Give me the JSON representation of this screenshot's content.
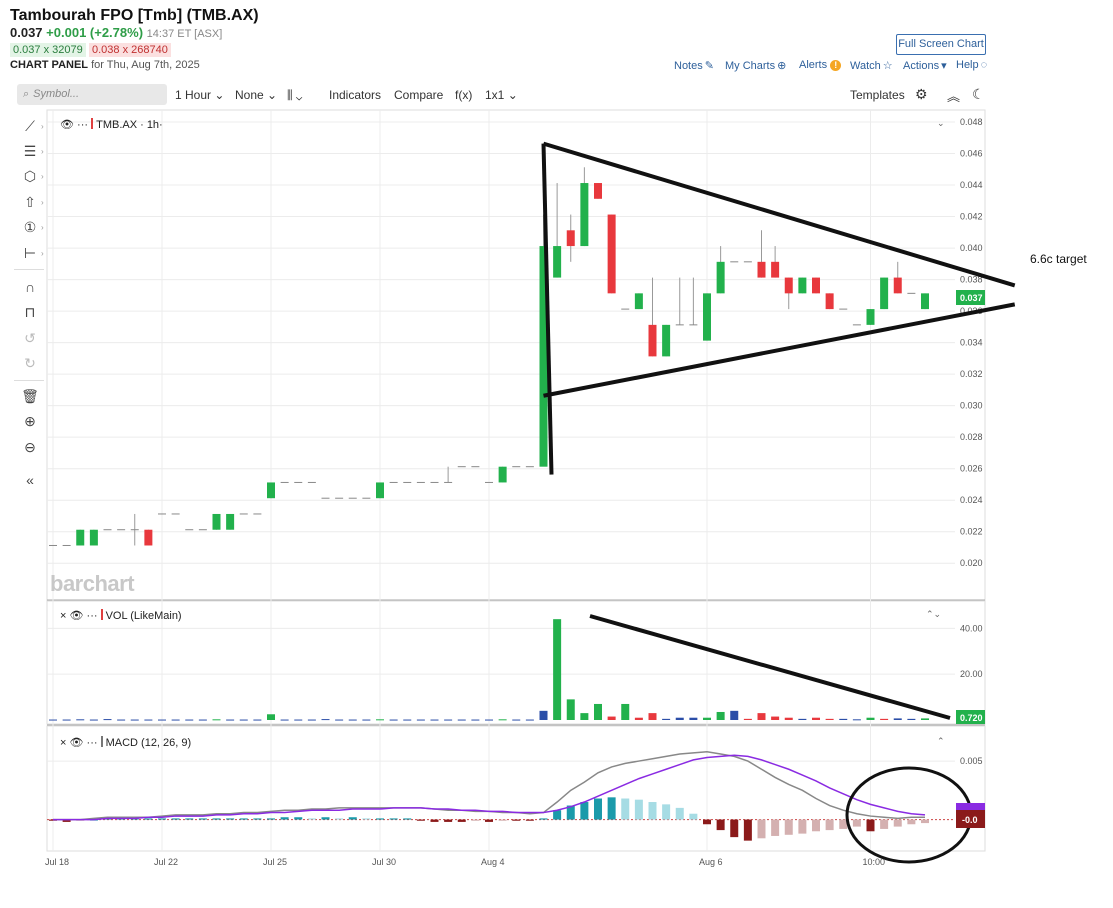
{
  "header": {
    "title": "Tambourah FPO [Tmb] (TMB.AX)",
    "last": "0.037",
    "change": "+0.001 (+2.78%)",
    "time": "14:37 ET [ASX]",
    "bid": "0.037 x 32079",
    "ask": "0.038 x 268740",
    "panel_label": "CHART PANEL",
    "panel_date": "for Thu, Aug 7th, 2025",
    "full_screen": "Full Screen Chart",
    "links": {
      "notes": "Notes",
      "my_charts": "My Charts",
      "alerts": "Alerts",
      "watch": "Watch",
      "actions": "Actions",
      "help": "Help"
    }
  },
  "toolbar": {
    "search_placeholder": "Symbol...",
    "interval": "1 Hour",
    "none": "None",
    "indicators": "Indicators",
    "compare": "Compare",
    "fx": "f(x)",
    "layout": "1x1",
    "templates": "Templates"
  },
  "panes": {
    "price_label": "TMB.AX · 1h·",
    "volume_label": "VOL (LikeMain)",
    "macd_label": "MACD (12, 26, 9)",
    "price_badge": "0.037",
    "volume_badge": "0.720",
    "macd_badge": "-0.0"
  },
  "annotation": "6.6c target",
  "watermark": "barchart",
  "colors": {
    "up": "#22b14c",
    "down": "#e8383d",
    "vol_blue": "#2b4ea8",
    "macd_line": "#888888",
    "signal_line": "#8a2be2",
    "hist_pos_strong": "#1b9aaa",
    "hist_pos_weak": "#a6dce4",
    "hist_neg_strong": "#8b1a1a",
    "hist_neg_weak": "#d4b0b0",
    "link": "#2d5f9a"
  },
  "chart_data": [
    {
      "type": "candlestick",
      "symbol": "TMB.AX",
      "interval": "1h",
      "ylim": [
        0.019,
        0.048
      ],
      "yticks": [
        "0.048",
        "0.046",
        "0.044",
        "0.042",
        "0.040",
        "0.038",
        "0.036",
        "0.034",
        "0.032",
        "0.030",
        "0.028",
        "0.026",
        "0.024",
        "0.022",
        "0.020"
      ],
      "xticks": [
        "Jul 18",
        "Jul 22",
        "Jul 25",
        "Jul 30",
        "Aug 4",
        "Aug 6",
        "10:00"
      ],
      "candles": [
        {
          "o": 0.021,
          "h": 0.021,
          "l": 0.021,
          "c": 0.021
        },
        {
          "o": 0.021,
          "h": 0.021,
          "l": 0.021,
          "c": 0.021
        },
        {
          "o": 0.021,
          "h": 0.022,
          "l": 0.021,
          "c": 0.022
        },
        {
          "o": 0.021,
          "h": 0.022,
          "l": 0.021,
          "c": 0.022
        },
        {
          "o": 0.022,
          "h": 0.022,
          "l": 0.022,
          "c": 0.022
        },
        {
          "o": 0.022,
          "h": 0.022,
          "l": 0.022,
          "c": 0.022
        },
        {
          "o": 0.022,
          "h": 0.023,
          "l": 0.021,
          "c": 0.022
        },
        {
          "o": 0.022,
          "h": 0.022,
          "l": 0.021,
          "c": 0.021
        },
        {
          "o": 0.023,
          "h": 0.023,
          "l": 0.023,
          "c": 0.023
        },
        {
          "o": 0.023,
          "h": 0.023,
          "l": 0.023,
          "c": 0.023
        },
        {
          "o": 0.022,
          "h": 0.022,
          "l": 0.022,
          "c": 0.022
        },
        {
          "o": 0.022,
          "h": 0.022,
          "l": 0.022,
          "c": 0.022
        },
        {
          "o": 0.022,
          "h": 0.023,
          "l": 0.022,
          "c": 0.023
        },
        {
          "o": 0.022,
          "h": 0.023,
          "l": 0.022,
          "c": 0.023
        },
        {
          "o": 0.023,
          "h": 0.023,
          "l": 0.023,
          "c": 0.023
        },
        {
          "o": 0.023,
          "h": 0.023,
          "l": 0.023,
          "c": 0.023
        },
        {
          "o": 0.024,
          "h": 0.025,
          "l": 0.024,
          "c": 0.025
        },
        {
          "o": 0.025,
          "h": 0.025,
          "l": 0.025,
          "c": 0.025
        },
        {
          "o": 0.025,
          "h": 0.025,
          "l": 0.025,
          "c": 0.025
        },
        {
          "o": 0.025,
          "h": 0.025,
          "l": 0.025,
          "c": 0.025
        },
        {
          "o": 0.024,
          "h": 0.024,
          "l": 0.024,
          "c": 0.024
        },
        {
          "o": 0.024,
          "h": 0.024,
          "l": 0.024,
          "c": 0.024
        },
        {
          "o": 0.024,
          "h": 0.024,
          "l": 0.024,
          "c": 0.024
        },
        {
          "o": 0.024,
          "h": 0.024,
          "l": 0.024,
          "c": 0.024
        },
        {
          "o": 0.024,
          "h": 0.025,
          "l": 0.024,
          "c": 0.025
        },
        {
          "o": 0.025,
          "h": 0.025,
          "l": 0.025,
          "c": 0.025
        },
        {
          "o": 0.025,
          "h": 0.025,
          "l": 0.025,
          "c": 0.025
        },
        {
          "o": 0.025,
          "h": 0.025,
          "l": 0.025,
          "c": 0.025
        },
        {
          "o": 0.025,
          "h": 0.025,
          "l": 0.025,
          "c": 0.025
        },
        {
          "o": 0.025,
          "h": 0.026,
          "l": 0.025,
          "c": 0.025
        },
        {
          "o": 0.026,
          "h": 0.026,
          "l": 0.026,
          "c": 0.026
        },
        {
          "o": 0.026,
          "h": 0.026,
          "l": 0.026,
          "c": 0.026
        },
        {
          "o": 0.025,
          "h": 0.025,
          "l": 0.025,
          "c": 0.025
        },
        {
          "o": 0.025,
          "h": 0.026,
          "l": 0.025,
          "c": 0.026
        },
        {
          "o": 0.026,
          "h": 0.026,
          "l": 0.026,
          "c": 0.026
        },
        {
          "o": 0.026,
          "h": 0.026,
          "l": 0.026,
          "c": 0.026
        },
        {
          "o": 0.026,
          "h": 0.042,
          "l": 0.031,
          "c": 0.04
        },
        {
          "o": 0.038,
          "h": 0.044,
          "l": 0.038,
          "c": 0.04
        },
        {
          "o": 0.041,
          "h": 0.042,
          "l": 0.039,
          "c": 0.04
        },
        {
          "o": 0.04,
          "h": 0.045,
          "l": 0.04,
          "c": 0.044
        },
        {
          "o": 0.044,
          "h": 0.044,
          "l": 0.043,
          "c": 0.043
        },
        {
          "o": 0.042,
          "h": 0.042,
          "l": 0.037,
          "c": 0.037
        },
        {
          "o": 0.036,
          "h": 0.036,
          "l": 0.036,
          "c": 0.036
        },
        {
          "o": 0.036,
          "h": 0.037,
          "l": 0.036,
          "c": 0.037
        },
        {
          "o": 0.035,
          "h": 0.038,
          "l": 0.033,
          "c": 0.033
        },
        {
          "o": 0.033,
          "h": 0.035,
          "l": 0.033,
          "c": 0.035
        },
        {
          "o": 0.035,
          "h": 0.038,
          "l": 0.035,
          "c": 0.035
        },
        {
          "o": 0.035,
          "h": 0.038,
          "l": 0.035,
          "c": 0.035
        },
        {
          "o": 0.034,
          "h": 0.037,
          "l": 0.034,
          "c": 0.037
        },
        {
          "o": 0.037,
          "h": 0.04,
          "l": 0.037,
          "c": 0.039
        },
        {
          "o": 0.039,
          "h": 0.039,
          "l": 0.039,
          "c": 0.039
        },
        {
          "o": 0.039,
          "h": 0.039,
          "l": 0.039,
          "c": 0.039
        },
        {
          "o": 0.039,
          "h": 0.041,
          "l": 0.038,
          "c": 0.038
        },
        {
          "o": 0.039,
          "h": 0.04,
          "l": 0.038,
          "c": 0.038
        },
        {
          "o": 0.038,
          "h": 0.038,
          "l": 0.036,
          "c": 0.037
        },
        {
          "o": 0.037,
          "h": 0.038,
          "l": 0.037,
          "c": 0.038
        },
        {
          "o": 0.038,
          "h": 0.038,
          "l": 0.037,
          "c": 0.037
        },
        {
          "o": 0.037,
          "h": 0.037,
          "l": 0.036,
          "c": 0.036
        },
        {
          "o": 0.036,
          "h": 0.036,
          "l": 0.036,
          "c": 0.036
        },
        {
          "o": 0.035,
          "h": 0.035,
          "l": 0.035,
          "c": 0.035
        },
        {
          "o": 0.035,
          "h": 0.036,
          "l": 0.035,
          "c": 0.036
        },
        {
          "o": 0.036,
          "h": 0.038,
          "l": 0.036,
          "c": 0.038
        },
        {
          "o": 0.038,
          "h": 0.039,
          "l": 0.037,
          "c": 0.037
        },
        {
          "o": 0.037,
          "h": 0.037,
          "l": 0.037,
          "c": 0.037
        },
        {
          "o": 0.036,
          "h": 0.037,
          "l": 0.036,
          "c": 0.037
        }
      ],
      "trendlines": [
        {
          "from": [
            36,
            0.0465
          ],
          "to": [
            70,
            0.0375
          ]
        },
        {
          "from": [
            36,
            0.0305
          ],
          "to": [
            70,
            0.0363
          ]
        },
        {
          "from": [
            36,
            0.0465
          ],
          "to": [
            36,
            0.0255
          ]
        }
      ]
    },
    {
      "type": "bar",
      "name": "VOL (LikeMain)",
      "ylim": [
        0,
        48
      ],
      "yticks": [
        "40.00",
        "20.00"
      ],
      "values": [
        0.2,
        0.2,
        0.3,
        0.2,
        0.4,
        0.2,
        0.2,
        0.2,
        0.2,
        0.2,
        0.2,
        0.2,
        0.3,
        0.2,
        0.2,
        0.2,
        2.5,
        0.2,
        0.2,
        0.2,
        0.4,
        0.2,
        0.2,
        0.2,
        0.3,
        0.2,
        0.2,
        0.2,
        0.2,
        0.2,
        0.2,
        0.2,
        0.2,
        0.3,
        0.2,
        0.2,
        4.0,
        44.0,
        9.0,
        3.0,
        7.0,
        1.5,
        7.0,
        1.0,
        3.0,
        0.5,
        1.0,
        1.0,
        1.0,
        3.5,
        4.0,
        0.5,
        3.0,
        1.5,
        1.0,
        0.5,
        1.0,
        0.5,
        0.5,
        0.3,
        1.0,
        0.5,
        0.7,
        0.5,
        0.7
      ],
      "bar_colors": [
        "b",
        "b",
        "b",
        "b",
        "b",
        "b",
        "b",
        "b",
        "b",
        "b",
        "b",
        "b",
        "g",
        "b",
        "b",
        "b",
        "g",
        "b",
        "b",
        "b",
        "b",
        "b",
        "b",
        "b",
        "g",
        "b",
        "b",
        "b",
        "b",
        "b",
        "b",
        "b",
        "b",
        "g",
        "b",
        "b",
        "b",
        "g",
        "g",
        "g",
        "g",
        "r",
        "g",
        "r",
        "r",
        "b",
        "b",
        "b",
        "g",
        "g",
        "b",
        "r",
        "r",
        "r",
        "r",
        "b",
        "r",
        "r",
        "b",
        "b",
        "g",
        "r",
        "b",
        "b",
        "g"
      ]
    },
    {
      "type": "macd",
      "name": "MACD (12, 26, 9)",
      "ylim": [
        -0.0026,
        0.0068
      ],
      "yticks": [
        "0.005"
      ],
      "macd": [
        0.0,
        0.0,
        0.0,
        0.0001,
        0.0002,
        0.0002,
        0.0002,
        0.0002,
        0.0003,
        0.0004,
        0.0004,
        0.0004,
        0.0005,
        0.0005,
        0.0006,
        0.0006,
        0.0007,
        0.0008,
        0.0008,
        0.0009,
        0.0009,
        0.001,
        0.001,
        0.001,
        0.001,
        0.001,
        0.001,
        0.001,
        0.0009,
        0.0008,
        0.0008,
        0.0007,
        0.0007,
        0.0006,
        0.0006,
        0.0005,
        0.0006,
        0.0015,
        0.0025,
        0.0032,
        0.004,
        0.0045,
        0.0048,
        0.005,
        0.0052,
        0.0054,
        0.0056,
        0.0057,
        0.0058,
        0.0056,
        0.0054,
        0.005,
        0.0043,
        0.0036,
        0.003,
        0.0025,
        0.0018,
        0.0012,
        0.0008,
        0.0005,
        0.0003,
        0.0002,
        0.0001,
        0.0002,
        0.0002
      ],
      "signal": [
        0.0,
        0.0,
        0.0,
        0.0,
        0.0001,
        0.0001,
        0.0001,
        0.0002,
        0.0002,
        0.0003,
        0.0003,
        0.0003,
        0.0004,
        0.0004,
        0.0005,
        0.0005,
        0.0006,
        0.0006,
        0.0007,
        0.0008,
        0.0008,
        0.0008,
        0.0009,
        0.0009,
        0.0009,
        0.001,
        0.001,
        0.001,
        0.0009,
        0.0009,
        0.0008,
        0.0008,
        0.0007,
        0.0007,
        0.0006,
        0.0006,
        0.0006,
        0.0008,
        0.0011,
        0.0015,
        0.002,
        0.0025,
        0.003,
        0.0035,
        0.0039,
        0.0043,
        0.0047,
        0.0051,
        0.0053,
        0.0054,
        0.0055,
        0.0054,
        0.0051,
        0.0047,
        0.0043,
        0.0038,
        0.0033,
        0.0027,
        0.0022,
        0.0017,
        0.0013,
        0.001,
        0.0007,
        0.0005,
        0.0004
      ],
      "histogram": [
        -0.0001,
        -0.0002,
        -0.0001,
        0.0,
        0.0001,
        0.0001,
        0.0001,
        0.0001,
        0.0001,
        0.0001,
        0.0001,
        0.0001,
        0.0001,
        0.0001,
        0.0001,
        0.0001,
        0.0001,
        0.0002,
        0.0002,
        0.0001,
        0.0002,
        0.0001,
        0.0002,
        0.0001,
        0.0001,
        0.0001,
        0.0001,
        -0.0001,
        -0.0002,
        -0.0002,
        -0.0002,
        -0.0001,
        -0.0002,
        -0.0001,
        -0.0001,
        -0.0001,
        0.0001,
        0.0008,
        0.0012,
        0.0015,
        0.0018,
        0.0019,
        0.0018,
        0.0017,
        0.0015,
        0.0013,
        0.001,
        0.0005,
        -0.0004,
        -0.0009,
        -0.0015,
        -0.0018,
        -0.0016,
        -0.0014,
        -0.0013,
        -0.0012,
        -0.001,
        -0.0009,
        -0.0008,
        -0.0006,
        -0.001,
        -0.0008,
        -0.0006,
        -0.0004,
        -0.0003
      ]
    }
  ]
}
